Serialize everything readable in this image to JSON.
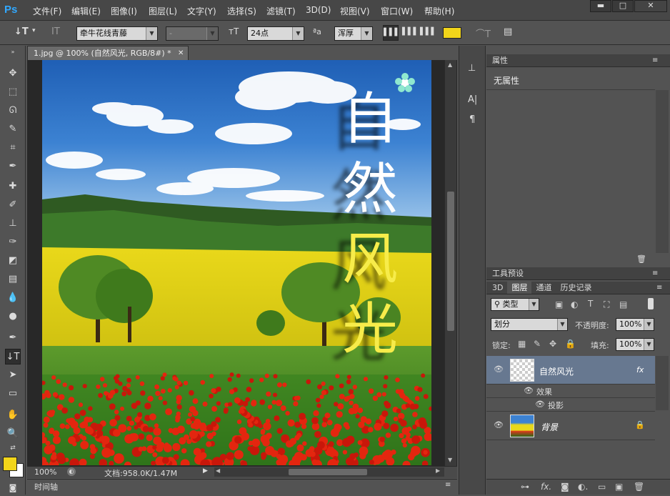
{
  "app": {
    "logo": "Ps"
  },
  "menu": [
    "文件(F)",
    "编辑(E)",
    "图像(I)",
    "图层(L)",
    "文字(Y)",
    "选择(S)",
    "滤镜(T)",
    "3D(D)",
    "视图(V)",
    "窗口(W)",
    "帮助(H)"
  ],
  "window_controls": {
    "minimize": "▬",
    "maximize": "□",
    "close": "✕"
  },
  "options": {
    "font_family": "牵牛花线青藤",
    "font_style": "-",
    "font_size": "24点",
    "aa_label": "ªa",
    "antialias": "浑厚",
    "text_color": "#f2d51a"
  },
  "document": {
    "tab_title": "1.jpg @ 100% (自然风光, RGB/8#) *",
    "zoom": "100%",
    "doc_info": "文档:958.0K/1.47M",
    "artwork_text": [
      "自",
      "然",
      "风",
      "光"
    ]
  },
  "timeline": {
    "label": "时间轴"
  },
  "properties": {
    "header": "属性",
    "content": "无属性"
  },
  "tool_presets": {
    "header": "工具预设"
  },
  "layers_panel": {
    "tabs": [
      "3D",
      "图层",
      "通道",
      "历史记录"
    ],
    "filter_label": "类型",
    "blend_mode": "划分",
    "opacity_label": "不透明度:",
    "opacity_value": "100%",
    "lock_label": "锁定:",
    "fill_label": "填充:",
    "fill_value": "100%",
    "layers": [
      {
        "name": "自然风光",
        "fx": "fx"
      },
      {
        "name": "背景"
      }
    ],
    "effects_label": "效果",
    "effect_item": "投影"
  },
  "colors": {
    "foreground": "#f2d51a",
    "background": "#ffffff",
    "accent": "#31a8ff"
  }
}
